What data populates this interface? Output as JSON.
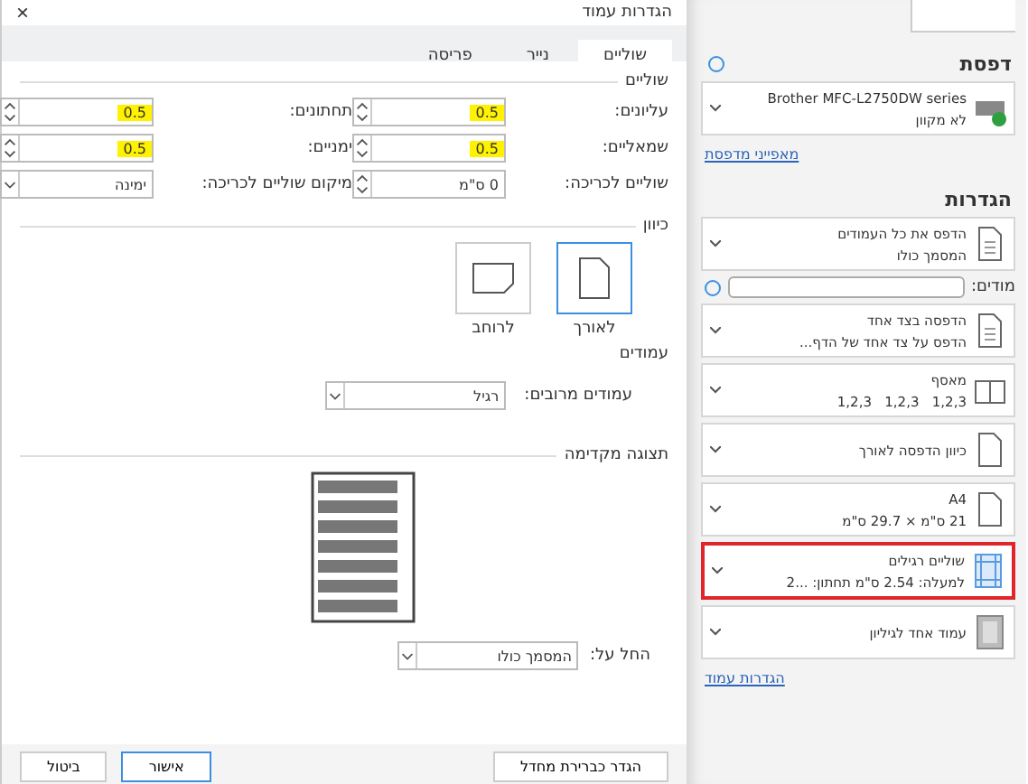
{
  "dialog": {
    "title": "הגדרות עמוד",
    "close": "×",
    "tabs": [
      {
        "label": "שוליים",
        "selected": true
      },
      {
        "label": "נייר",
        "selected": false
      },
      {
        "label": "פריסה",
        "selected": false
      }
    ],
    "margins": {
      "heading": "שוליים",
      "fields": [
        {
          "label": "עליונים:",
          "value": "0.5",
          "kind": "spin",
          "highlighted": true
        },
        {
          "label": "תחתונים:",
          "value": "0.5",
          "kind": "spin",
          "highlighted": true
        },
        {
          "label": "שמאליים:",
          "value": "0.5",
          "kind": "spin",
          "highlighted": true
        },
        {
          "label": "ימניים:",
          "value": "0.5",
          "kind": "spin",
          "highlighted": true
        },
        {
          "label": "שוליים לכריכה:",
          "value": "0 ס\"מ",
          "kind": "spin",
          "highlighted": false
        },
        {
          "label": "מיקום שוליים לכריכה:",
          "value": "ימינה",
          "kind": "select",
          "highlighted": false
        }
      ]
    },
    "orientation": {
      "heading": "כיוון",
      "options": [
        {
          "label": "לאורך",
          "kind": "portrait",
          "selected": true
        },
        {
          "label": "לרוחב",
          "kind": "landscape",
          "selected": false
        }
      ]
    },
    "pages": {
      "heading": "עמודים",
      "label": "עמודים מרובים:",
      "value": "רגיל"
    },
    "preview": {
      "heading": "תצוגה מקדימה",
      "apply_label": "החל על:",
      "apply_value": "המסמך כולו"
    },
    "buttons": [
      {
        "label": "הגדר כברירת מחדל",
        "kind": "plain"
      },
      {
        "label": "אישור",
        "kind": "primary"
      },
      {
        "label": "ביטול",
        "kind": "plain"
      }
    ]
  },
  "print_panel": {
    "printer_heading": "דפסת",
    "printer": {
      "name": "Brother MFC-L2750DW series",
      "status": "לא מקוון"
    },
    "printer_link": "מאפייני מדפסת",
    "settings_heading": "הגדרות",
    "cards": [
      {
        "kind": "pages",
        "title": "הדפס את כל העמודים",
        "subtitle": "המסמך כולו",
        "highlighted": false
      },
      {
        "kind": "pages_field",
        "label": "מודים:"
      },
      {
        "kind": "sides",
        "title": "הדפסה בצד אחד",
        "subtitle": "הדפס על צד אחד של הדף...",
        "highlighted": false
      },
      {
        "kind": "collate",
        "title": "מאסף",
        "subtitle": "1,2,3   1,2,3   1,2,3",
        "highlighted": false
      },
      {
        "kind": "orientation",
        "title": "כיוון הדפסה לאורך",
        "highlighted": false
      },
      {
        "kind": "paper",
        "title": "A4",
        "subtitle": "21 ס\"מ × 29.7 ס\"מ",
        "highlighted": false
      },
      {
        "kind": "margins",
        "title": "שוליים רגילים",
        "subtitle": "למעלה: 2.54 ס\"מ תחתון: ...2",
        "highlighted": true
      },
      {
        "kind": "persheet",
        "title": "עמוד אחד לגיליון",
        "highlighted": false
      }
    ],
    "page_setup_link": "הגדרות עמוד"
  }
}
